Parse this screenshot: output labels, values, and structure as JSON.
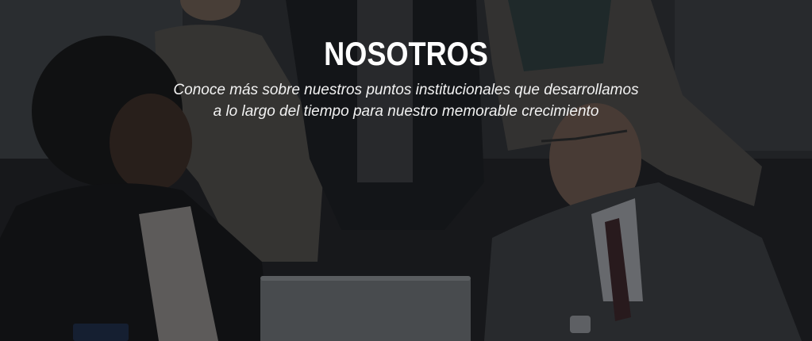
{
  "hero": {
    "title": "NOSOTROS",
    "subtitle_line1": "Conoce más sobre nuestros puntos institucionales que desarrollamos",
    "subtitle_line2": "a lo largo del tiempo para nuestro memorable crecimiento",
    "background_image": "office-team-meeting-photo",
    "overlay_color": "#0a0b0d"
  }
}
